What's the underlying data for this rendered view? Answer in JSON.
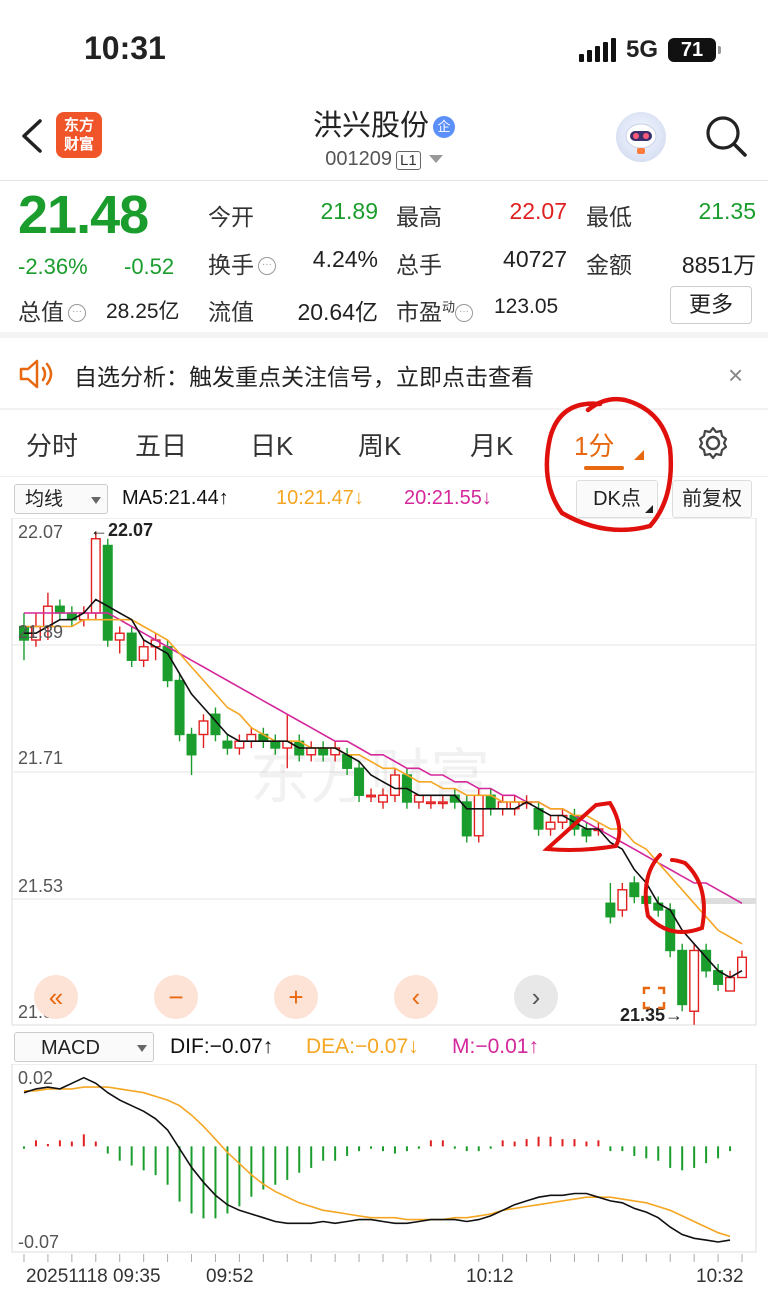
{
  "status": {
    "time": "10:31",
    "network": "5G",
    "battery": "71"
  },
  "header": {
    "logo": [
      "东方",
      "财富"
    ],
    "stock_name": "洪兴股份",
    "name_badge": "企",
    "stock_code": "001209",
    "level": "L1"
  },
  "quote": {
    "price": "21.48",
    "change_pct": "-2.36%",
    "change_abs": "-0.52",
    "fields": {
      "open_label": "今开",
      "open": "21.89",
      "high_label": "最高",
      "high": "22.07",
      "low_label": "最低",
      "low": "21.35",
      "turnover_label": "换手",
      "turnover": "4.24%",
      "volume_label": "总手",
      "volume": "40727",
      "amount_label": "金额",
      "amount": "8851万",
      "mktcap_label": "总值",
      "mktcap": "28.25亿",
      "float_label": "流值",
      "float": "20.64亿",
      "pe_label": "市盈",
      "pe_sup": "动",
      "pe": "123.05"
    },
    "more": "更多"
  },
  "alert": {
    "text": "自选分析：触发重点关注信号，立即点击查看",
    "close": "×"
  },
  "tabs": [
    "分时",
    "五日",
    "日K",
    "周K",
    "月K",
    "1分"
  ],
  "indicators": {
    "ma_select": "均线",
    "ma5": "MA5:21.44↑",
    "ma10": "10:21.47↓",
    "ma20": "20:21.55↓",
    "dk": "DK点",
    "adjust": "前复权"
  },
  "macd": {
    "select": "MACD",
    "dif": "DIF:−0.07↑",
    "dea": "DEA:−0.07↓",
    "m": "M:−0.01↑",
    "ytop": "0.02",
    "ybottom": "-0.07"
  },
  "axis": {
    "y": [
      "22.07",
      "21.89",
      "21.71",
      "21.53",
      "21.35"
    ],
    "x": [
      "20251118 09:35",
      "09:52",
      "10:12",
      "10:32"
    ]
  },
  "chart_data": {
    "type": "candlestick",
    "ylim": [
      21.35,
      22.07
    ],
    "high_label": "22.07",
    "low_label": "21.35",
    "ohlc": [
      [
        21.93,
        21.95,
        21.88,
        21.91
      ],
      [
        21.91,
        21.95,
        21.9,
        21.93
      ],
      [
        21.93,
        21.98,
        21.91,
        21.96
      ],
      [
        21.96,
        21.97,
        21.94,
        21.95
      ],
      [
        21.95,
        21.96,
        21.93,
        21.94
      ],
      [
        21.94,
        21.96,
        21.93,
        21.95
      ],
      [
        21.95,
        22.07,
        21.94,
        22.06
      ],
      [
        22.05,
        22.06,
        21.9,
        21.91
      ],
      [
        21.91,
        21.93,
        21.89,
        21.92
      ],
      [
        21.92,
        21.93,
        21.87,
        21.88
      ],
      [
        21.88,
        21.91,
        21.87,
        21.9
      ],
      [
        21.9,
        21.92,
        21.88,
        21.91
      ],
      [
        21.9,
        21.91,
        21.84,
        21.85
      ],
      [
        21.85,
        21.86,
        21.76,
        21.77
      ],
      [
        21.77,
        21.78,
        21.71,
        21.74
      ],
      [
        21.77,
        21.8,
        21.75,
        21.79
      ],
      [
        21.8,
        21.81,
        21.76,
        21.77
      ],
      [
        21.76,
        21.77,
        21.74,
        21.75
      ],
      [
        21.75,
        21.77,
        21.74,
        21.76
      ],
      [
        21.76,
        21.78,
        21.75,
        21.77
      ],
      [
        21.77,
        21.78,
        21.75,
        21.76
      ],
      [
        21.76,
        21.77,
        21.74,
        21.75
      ],
      [
        21.75,
        21.8,
        21.72,
        21.76
      ],
      [
        21.76,
        21.77,
        21.73,
        21.74
      ],
      [
        21.74,
        21.76,
        21.73,
        21.75
      ],
      [
        21.75,
        21.76,
        21.73,
        21.74
      ],
      [
        21.74,
        21.76,
        21.73,
        21.75
      ],
      [
        21.74,
        21.75,
        21.71,
        21.72
      ],
      [
        21.72,
        21.73,
        21.67,
        21.68
      ],
      [
        21.68,
        21.69,
        21.67,
        21.68
      ],
      [
        21.67,
        21.69,
        21.66,
        21.68
      ],
      [
        21.68,
        21.72,
        21.67,
        21.71
      ],
      [
        21.71,
        21.72,
        21.66,
        21.67
      ],
      [
        21.67,
        21.68,
        21.66,
        21.68
      ],
      [
        21.67,
        21.68,
        21.66,
        21.67
      ],
      [
        21.67,
        21.68,
        21.66,
        21.67
      ],
      [
        21.68,
        21.69,
        21.66,
        21.67
      ],
      [
        21.67,
        21.68,
        21.61,
        21.62
      ],
      [
        21.62,
        21.69,
        21.61,
        21.68
      ],
      [
        21.68,
        21.69,
        21.65,
        21.66
      ],
      [
        21.66,
        21.68,
        21.65,
        21.67
      ],
      [
        21.66,
        21.68,
        21.65,
        21.67
      ],
      [
        21.67,
        21.68,
        21.66,
        21.67
      ],
      [
        21.66,
        21.67,
        21.62,
        21.63
      ],
      [
        21.63,
        21.65,
        21.62,
        21.64
      ],
      [
        21.64,
        21.66,
        21.63,
        21.65
      ],
      [
        21.65,
        21.66,
        21.62,
        21.63
      ],
      [
        21.63,
        21.64,
        21.61,
        21.62
      ],
      [
        21.63,
        21.64,
        21.62,
        21.63
      ],
      [
        21.52,
        21.55,
        21.49,
        21.5
      ],
      [
        21.51,
        21.55,
        21.5,
        21.54
      ],
      [
        21.55,
        21.56,
        21.52,
        21.53
      ],
      [
        21.53,
        21.54,
        21.51,
        21.52
      ],
      [
        21.52,
        21.53,
        21.5,
        21.51
      ],
      [
        21.51,
        21.52,
        21.44,
        21.45
      ],
      [
        21.45,
        21.46,
        21.36,
        21.37
      ],
      [
        21.36,
        21.46,
        21.34,
        21.45
      ],
      [
        21.45,
        21.46,
        21.41,
        21.42
      ],
      [
        21.42,
        21.43,
        21.39,
        21.4
      ],
      [
        21.39,
        21.42,
        21.39,
        21.41
      ],
      [
        21.41,
        21.45,
        21.41,
        21.44
      ]
    ],
    "ma5": [
      21.92,
      21.92,
      21.93,
      21.94,
      21.94,
      21.95,
      21.97,
      21.96,
      21.95,
      21.94,
      21.91,
      21.9,
      21.89,
      21.86,
      21.83,
      21.81,
      21.79,
      21.77,
      21.76,
      21.76,
      21.76,
      21.76,
      21.76,
      21.75,
      21.75,
      21.75,
      21.75,
      21.74,
      21.73,
      21.71,
      21.7,
      21.69,
      21.69,
      21.68,
      21.68,
      21.68,
      21.68,
      21.66,
      21.66,
      21.66,
      21.66,
      21.66,
      21.67,
      21.66,
      21.65,
      21.65,
      21.64,
      21.63,
      21.63,
      21.61,
      21.6,
      21.57,
      21.55,
      21.52,
      21.51,
      21.48,
      21.46,
      21.44,
      21.42,
      21.41,
      21.42
    ],
    "ma10": [
      21.93,
      21.93,
      21.93,
      21.93,
      21.93,
      21.94,
      21.94,
      21.94,
      21.94,
      21.94,
      21.93,
      21.92,
      21.91,
      21.89,
      21.87,
      21.85,
      21.83,
      21.81,
      21.8,
      21.78,
      21.77,
      21.76,
      21.76,
      21.76,
      21.75,
      21.75,
      21.75,
      21.74,
      21.74,
      21.73,
      21.72,
      21.72,
      21.71,
      21.7,
      21.7,
      21.69,
      21.69,
      21.68,
      21.68,
      21.68,
      21.67,
      21.67,
      21.67,
      21.67,
      21.66,
      21.66,
      21.65,
      21.65,
      21.64,
      21.63,
      21.63,
      21.61,
      21.6,
      21.58,
      21.56,
      21.54,
      21.52,
      21.5,
      21.48,
      21.47,
      21.46
    ],
    "ma20": [
      21.95,
      21.95,
      21.95,
      21.95,
      21.95,
      21.95,
      21.95,
      21.95,
      21.94,
      21.93,
      21.92,
      21.91,
      21.9,
      21.89,
      21.88,
      21.87,
      21.86,
      21.85,
      21.84,
      21.83,
      21.82,
      21.81,
      21.8,
      21.79,
      21.78,
      21.77,
      21.76,
      21.76,
      21.75,
      21.74,
      21.74,
      21.73,
      21.72,
      21.72,
      21.71,
      21.71,
      21.7,
      21.7,
      21.69,
      21.69,
      21.68,
      21.68,
      21.67,
      21.67,
      21.66,
      21.66,
      21.65,
      21.64,
      21.63,
      21.62,
      21.61,
      21.6,
      21.59,
      21.58,
      21.57,
      21.56,
      21.55,
      21.55,
      21.54,
      21.53,
      21.52
    ],
    "macd_ylim": [
      -0.07,
      0.02
    ],
    "dif": [
      0.01,
      0.012,
      0.013,
      0.012,
      0.015,
      0.018,
      0.015,
      0.01,
      0.006,
      0.003,
      0.0,
      -0.004,
      -0.01,
      -0.02,
      -0.03,
      -0.038,
      -0.045,
      -0.05,
      -0.053,
      -0.055,
      -0.057,
      -0.059,
      -0.06,
      -0.06,
      -0.06,
      -0.059,
      -0.06,
      -0.059,
      -0.058,
      -0.058,
      -0.059,
      -0.06,
      -0.06,
      -0.059,
      -0.058,
      -0.058,
      -0.058,
      -0.059,
      -0.058,
      -0.056,
      -0.053,
      -0.05,
      -0.048,
      -0.046,
      -0.045,
      -0.045,
      -0.044,
      -0.044,
      -0.046,
      -0.048,
      -0.049,
      -0.052,
      -0.054,
      -0.057,
      -0.062,
      -0.066,
      -0.068,
      -0.069,
      -0.07,
      -0.069
    ],
    "dea": [
      0.011,
      0.011,
      0.012,
      0.012,
      0.012,
      0.013,
      0.013,
      0.013,
      0.012,
      0.011,
      0.01,
      0.008,
      0.006,
      0.003,
      -0.002,
      -0.008,
      -0.015,
      -0.022,
      -0.028,
      -0.034,
      -0.039,
      -0.043,
      -0.046,
      -0.049,
      -0.051,
      -0.053,
      -0.054,
      -0.055,
      -0.056,
      -0.057,
      -0.057,
      -0.057,
      -0.058,
      -0.058,
      -0.058,
      -0.058,
      -0.057,
      -0.057,
      -0.056,
      -0.055,
      -0.053,
      -0.052,
      -0.051,
      -0.05,
      -0.049,
      -0.048,
      -0.047,
      -0.046,
      -0.046,
      -0.046,
      -0.047,
      -0.048,
      -0.049,
      -0.051,
      -0.053,
      -0.056,
      -0.059,
      -0.062,
      -0.065,
      -0.067
    ],
    "macd_hist": [
      -0.001,
      0.0,
      0.001,
      0.0,
      0.002,
      0.005,
      0.002,
      -0.003,
      -0.006,
      -0.008,
      -0.01,
      -0.012,
      -0.016,
      -0.023,
      -0.028,
      -0.03,
      -0.03,
      -0.028,
      -0.025,
      -0.021,
      -0.018,
      -0.016,
      -0.014,
      -0.011,
      -0.009,
      -0.006,
      -0.006,
      -0.004,
      -0.002,
      -0.001,
      -0.002,
      -0.003,
      -0.002,
      -0.001,
      0.0,
      0.0,
      -0.001,
      -0.002,
      -0.002,
      -0.001,
      0.0,
      0.002,
      0.003,
      0.004,
      0.004,
      0.003,
      0.003,
      0.002,
      0.0,
      -0.002,
      -0.002,
      -0.004,
      -0.005,
      -0.006,
      -0.009,
      -0.01,
      -0.009,
      -0.007,
      -0.005,
      -0.002
    ]
  },
  "colors": {
    "up": "#e02020",
    "down": "#1a9d2c",
    "ma5": "#111111",
    "ma10": "#f5a623",
    "ma20": "#d4299b",
    "accent": "#e8680f",
    "annotation": "#e0100c"
  }
}
